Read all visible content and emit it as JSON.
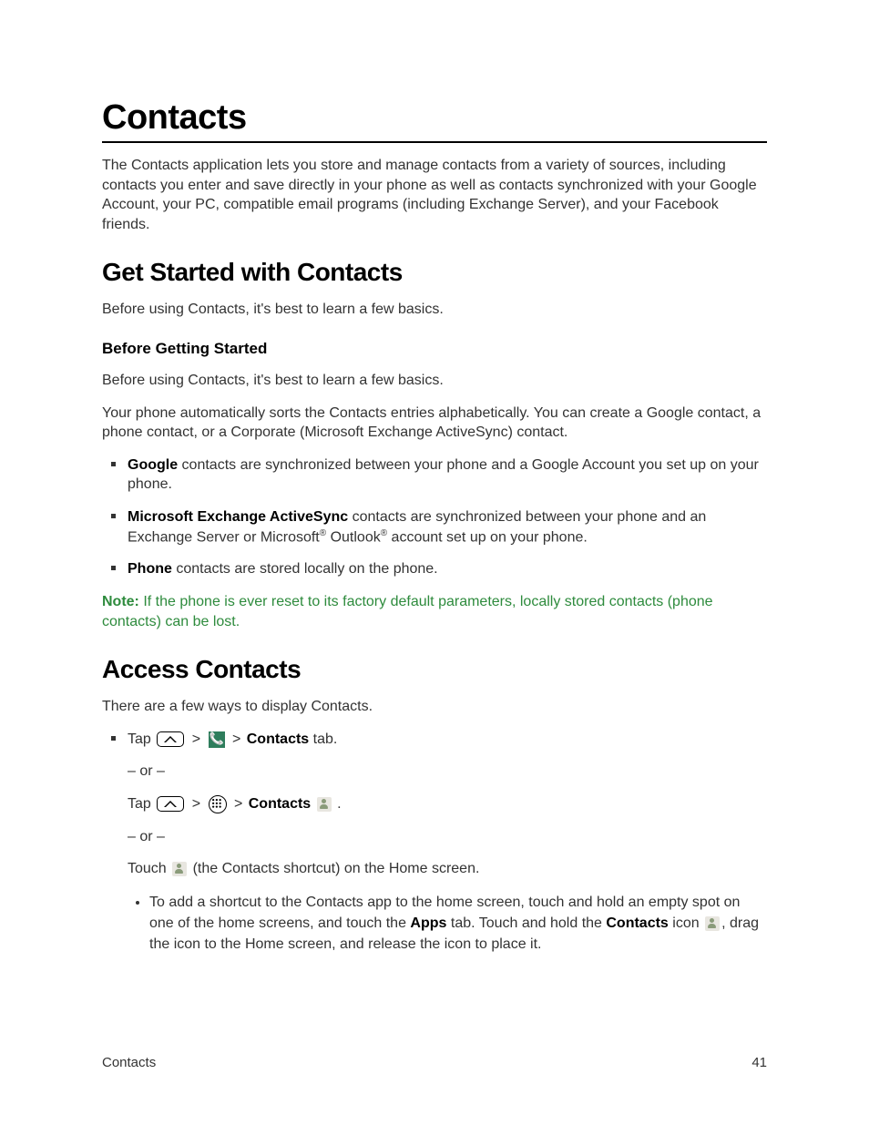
{
  "title": "Contacts",
  "intro": "The Contacts application lets you store and manage contacts from a variety of sources, including contacts you enter and save directly in your phone as well as contacts synchronized with your Google Account, your PC, compatible email programs (including Exchange Server), and your Facebook friends.",
  "section1": {
    "heading": "Get Started with Contacts",
    "lead": "Before using Contacts, it's best to learn a few basics.",
    "sub1": {
      "heading": "Before Getting Started",
      "p1": "Before using Contacts, it's best to learn a few basics.",
      "p2": "Your phone automatically sorts the Contacts entries alphabetically. You can create a Google contact, a phone contact, or a Corporate (Microsoft Exchange ActiveSync) contact.",
      "bullets": {
        "b1_bold": "Google",
        "b1_rest": " contacts are synchronized between your phone and a Google Account you set up on your phone.",
        "b2_bold": "Microsoft Exchange ActiveSync",
        "b2_mid": " contacts are synchronized between your phone and an Exchange Server or Microsoft",
        "b2_reg": "®",
        "b2_mid2": " Outlook",
        "b2_reg2": "®",
        "b2_end": " account set up on your phone.",
        "b3_bold": "Phone",
        "b3_rest": " contacts are stored locally on the phone."
      },
      "note_label": "Note:",
      "note_text": " If the phone is ever reset to its factory default parameters, locally stored contacts (phone contacts) can be lost."
    }
  },
  "section2": {
    "heading": "Access Contacts",
    "lead": "There are a few ways to display Contacts.",
    "tap": "Tap",
    "gt": ">",
    "contacts_bold": "Contacts",
    "tab_suffix": " tab.",
    "or": "– or –",
    "period": " .",
    "touch": "Touch ",
    "shortcut_suffix": " (the Contacts shortcut) on the Home screen.",
    "sub_bullet_pre": "To add a shortcut to the Contacts app to the home screen, touch and hold an empty spot on one of the home screens, and touch the ",
    "apps_bold": "Apps",
    "sub_bullet_mid": " tab. Touch and hold the ",
    "sub_bullet_mid2": " icon ",
    "sub_bullet_end": ", drag the icon to the Home screen, and release the icon to place it."
  },
  "footer": {
    "left": "Contacts",
    "right": "41"
  }
}
